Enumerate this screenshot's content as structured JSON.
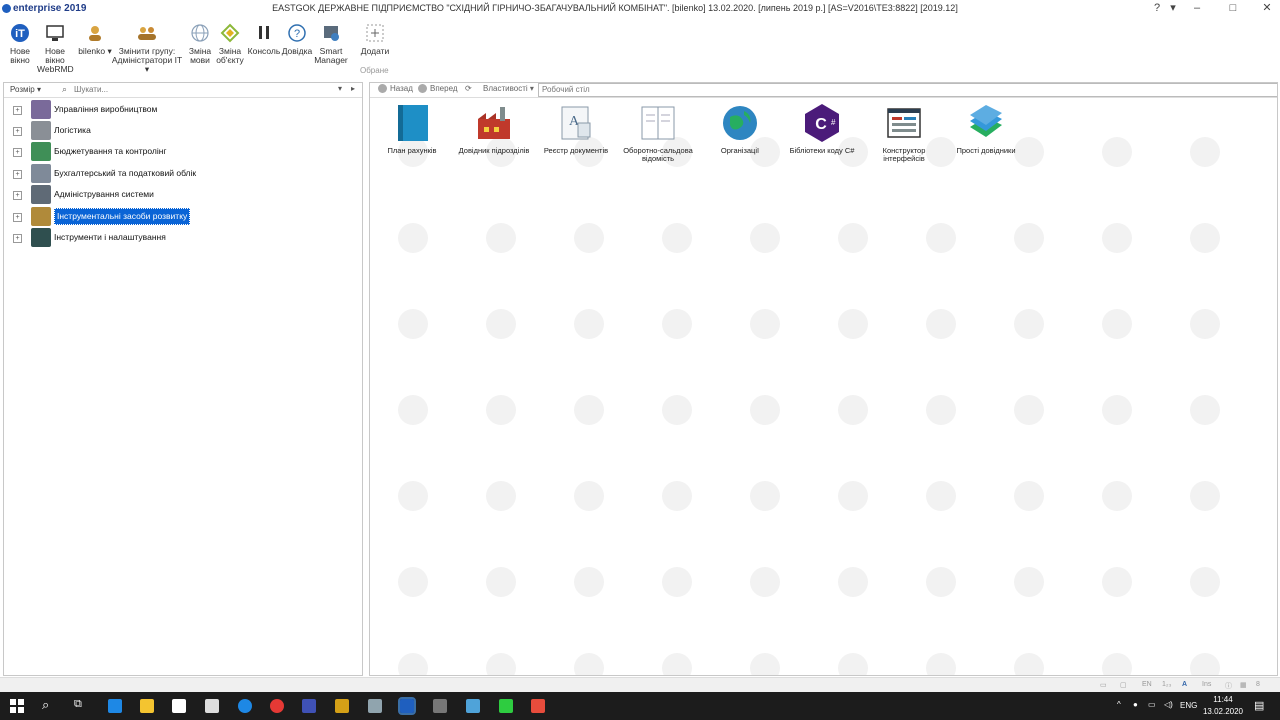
{
  "window": {
    "app_name": "enterprise 2019",
    "title": "EASTGOK ДЕРЖАВНЕ ПІДПРИЄМСТВО \"СХІДНИЙ ГІРНИЧО-ЗБАГАЧУВАЛЬНИЙ КОМБІНАТ\". [bilenko] 13.02.2020. [липень 2019 р.] [AS=V2016\\TE3:8822] [2019.12]",
    "help_icon": "?",
    "menu_icon": "▾",
    "pin_icon": "·",
    "minimize": "–",
    "maximize": "□",
    "close": "✕"
  },
  "ribbon": {
    "tools": [
      {
        "id": "new-window",
        "label": "Нове вікно",
        "icon": "logo-icon"
      },
      {
        "id": "new-window-webrmd",
        "label": "Нове вікно WebRMD",
        "icon": "monitor-icon"
      },
      {
        "id": "user",
        "label": "bilenko ▾",
        "icon": "user-icon"
      },
      {
        "id": "change-group",
        "label": "Змінити групу: Адміністратори ІТ ▾",
        "icon": "group-icon"
      },
      {
        "id": "change-language",
        "label": "Зміна мови",
        "icon": "globe-icon"
      },
      {
        "id": "change-object",
        "label": "Зміна об'єкту",
        "icon": "diamond-icon"
      },
      {
        "id": "console",
        "label": "Консоль",
        "icon": "pause-icon"
      },
      {
        "id": "help",
        "label": "Довідка",
        "icon": "help-icon"
      },
      {
        "id": "smart-manager",
        "label": "Smart Manager",
        "icon": "smart-manager-icon"
      },
      {
        "id": "add",
        "label": "Додати",
        "icon": "add-icon"
      }
    ],
    "favorites_label": "Обране"
  },
  "left_panel": {
    "size_button": "Розмір ▾",
    "search_placeholder": "Шукати...",
    "tree": [
      {
        "label": "Управління виробництвом",
        "icon": "production-icon",
        "color": "#7a6a9a"
      },
      {
        "label": "Логістика",
        "icon": "logistics-icon",
        "color": "#8a8f96"
      },
      {
        "label": "Бюджетування та контролінг",
        "icon": "budget-icon",
        "color": "#3f8f57"
      },
      {
        "label": "Бухгалтерський та податковий облік",
        "icon": "accounting-icon",
        "color": "#7f8a99"
      },
      {
        "label": "Адміністрування системи",
        "icon": "admin-icon",
        "color": "#5f6a76"
      },
      {
        "label": "Інструментальні засоби розвитку",
        "icon": "dev-tools-icon",
        "color": "#b08a3a",
        "selected": true
      },
      {
        "label": "Інструменти і налаштування",
        "icon": "settings-tools-icon",
        "color": "#2f4f4f"
      }
    ]
  },
  "right_panel": {
    "back": "Назад",
    "forward": "Вперед",
    "properties": "Властивості ▾",
    "address": "Робочий стіл",
    "items": [
      {
        "label": "План рахунків",
        "icon": "chart-of-accounts-icon"
      },
      {
        "label": "Довідник підрозділів",
        "icon": "departments-icon"
      },
      {
        "label": "Реєстр документів",
        "icon": "documents-registry-icon"
      },
      {
        "label": "Оборотно-сальдова відомість",
        "icon": "turnover-balance-icon"
      },
      {
        "label": "Організації",
        "icon": "globe-icon"
      },
      {
        "label": "Бібліотеки коду C#",
        "icon": "csharp-icon"
      },
      {
        "label": "Конструктор інтерфейсів",
        "icon": "interface-builder-icon"
      },
      {
        "label": "Прості довідники",
        "icon": "simple-dictionaries-icon"
      }
    ]
  },
  "statusbar": {
    "lang": "EN",
    "num": "1₂₃",
    "caps": "A",
    "ins": "Ins",
    "count": "8"
  },
  "taskbar": {
    "language": "ENG",
    "time": "11:44",
    "date": "13.02.2020"
  }
}
